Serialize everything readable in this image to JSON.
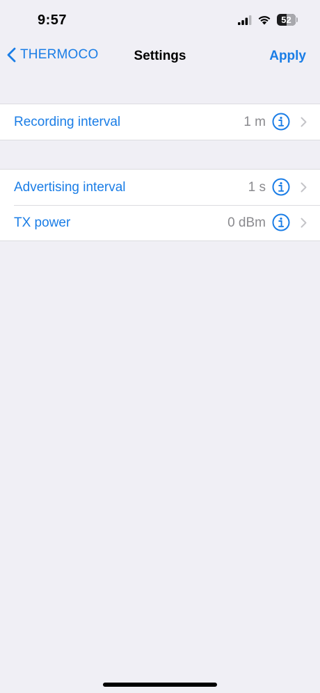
{
  "status_bar": {
    "time": "9:57",
    "battery_level": "52",
    "battery_fraction": 0.52,
    "signal_icon": "cellular-signal-icon",
    "wifi_icon": "wifi-icon",
    "battery_icon": "battery-icon"
  },
  "nav": {
    "back_label": "THERMOCO",
    "back_icon": "chevron-left-icon",
    "title": "Settings",
    "apply_label": "Apply"
  },
  "sections": [
    {
      "rows": [
        {
          "label": "Recording interval",
          "value": "1 m"
        }
      ]
    },
    {
      "rows": [
        {
          "label": "Advertising interval",
          "value": "1 s"
        },
        {
          "label": "TX power",
          "value": "0 dBm"
        }
      ]
    }
  ],
  "colors": {
    "accent": "#1a7de6",
    "background": "#f0eff5",
    "cell": "#ffffff",
    "secondary_text": "#8a8a8e"
  }
}
